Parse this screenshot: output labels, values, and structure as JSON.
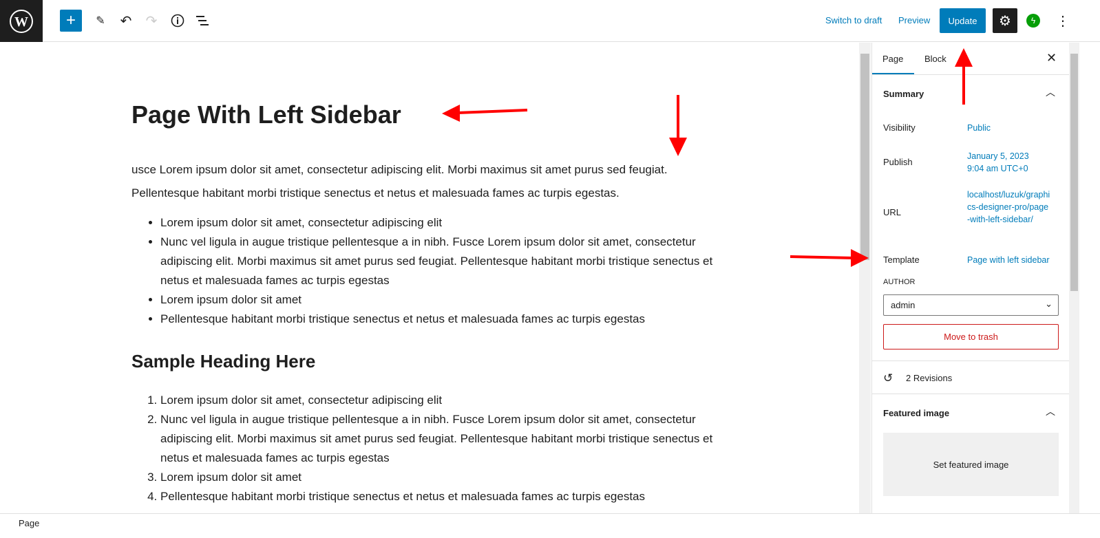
{
  "toolbar": {
    "switch_draft": "Switch to draft",
    "preview": "Preview",
    "update": "Update"
  },
  "post": {
    "title": "Page With Left Sidebar",
    "paragraph": "usce Lorem ipsum dolor sit amet, consectetur adipiscing elit. Morbi maximus sit amet purus sed feugiat. Pellentesque habitant morbi tristique senectus et netus et malesuada fames ac turpis egestas.",
    "bullets": [
      "Lorem ipsum dolor sit amet, consectetur adipiscing elit",
      "Nunc vel ligula in augue tristique pellentesque a in nibh. Fusce Lorem ipsum dolor sit amet, consectetur adipiscing elit. Morbi maximus sit amet purus sed feugiat. Pellentesque habitant morbi tristique senectus et netus et malesuada fames ac turpis egestas",
      "Lorem ipsum dolor sit amet",
      "Pellentesque habitant morbi tristique senectus et netus et malesuada fames ac turpis egestas"
    ],
    "heading2": "Sample Heading Here",
    "numbered": [
      "Lorem ipsum dolor sit amet, consectetur adipiscing elit",
      "Nunc vel ligula in augue tristique pellentesque a in nibh. Fusce Lorem ipsum dolor sit amet, consectetur adipiscing elit. Morbi maximus sit amet purus sed feugiat. Pellentesque habitant morbi tristique senectus et netus et malesuada fames ac turpis egestas",
      "Lorem ipsum dolor sit amet",
      "Pellentesque habitant morbi tristique senectus et netus et malesuada fames ac turpis egestas"
    ]
  },
  "sidebar": {
    "tabs": [
      "Page",
      "Block"
    ],
    "summary": "Summary",
    "visibility_label": "Visibility",
    "visibility": "Public",
    "publish_label": "Publish",
    "publish": "January 5, 2023 9:04 am UTC+0",
    "url_label": "URL",
    "url": "localhost/luzuk/graphics-designer-pro/page-with-left-sidebar/",
    "template_label": "Template",
    "template": "Page with left sidebar",
    "author_label": "AUTHOR",
    "author": "admin",
    "trash": "Move to trash",
    "revisions": "2 Revisions",
    "featured": "Featured image",
    "set_featured": "Set featured image"
  },
  "footer": {
    "breadcrumb": "Page"
  },
  "colors": {
    "accent": "#007cba",
    "annotation": "#ff0000"
  }
}
